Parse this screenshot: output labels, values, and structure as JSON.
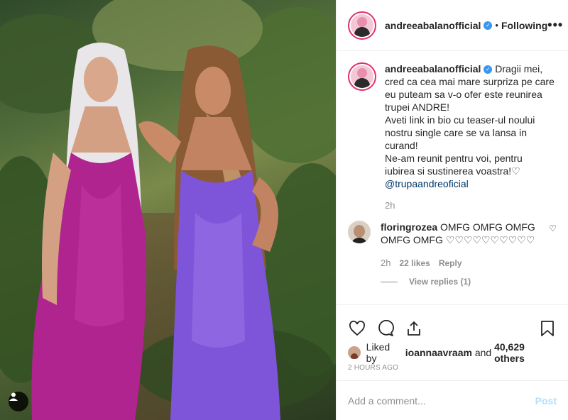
{
  "post": {
    "username": "andreeabalanofficial",
    "verified_icon": "verified-badge-icon",
    "follow_status": "Following",
    "more_icon": "more-options-icon",
    "separator": "•",
    "ellipsis": "•••"
  },
  "caption": {
    "username": "andreeabalanofficial",
    "lines": [
      "Dragii mei,",
      "cred ca cea mai mare surpriza pe care",
      "eu puteam sa v-o ofer este reunirea",
      "trupei ANDRE!",
      "Aveti link in bio cu teaser-ul noului",
      "nostru single care se va lansa in",
      "curand!",
      "Ne-am reunit pentru voi, pentru",
      "iubirea si sustinerea voastra!♡"
    ],
    "mention": "@trupaandreoficial",
    "time": "2h"
  },
  "comment": {
    "username": "floringrozea",
    "text": "OMFG OMFG OMFG OMFG OMFG ♡♡♡♡♡♡♡♡♡♡",
    "time": "2h",
    "likes": "22 likes",
    "reply_label": "Reply",
    "view_replies": "View replies (1)"
  },
  "actions": {
    "like_icon": "heart-icon",
    "comment_icon": "comment-icon",
    "share_icon": "share-icon",
    "save_icon": "bookmark-icon"
  },
  "likes": {
    "prefix": "Liked by ",
    "user": "ioannaavraam",
    "middle": " and ",
    "count": "40,629 others"
  },
  "timestamp": "2 HOURS AGO",
  "add_comment": {
    "placeholder": "Add a comment...",
    "post_label": "Post"
  },
  "colors": {
    "accent_link": "#00376b",
    "verified": "#3897f0",
    "post_disabled": "#b2dffc",
    "muted": "#8e8e8e"
  }
}
